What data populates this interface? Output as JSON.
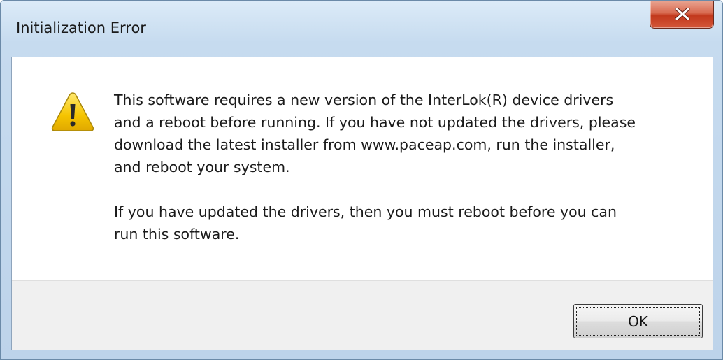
{
  "window": {
    "title": "Initialization Error",
    "close_icon": "close-x-icon"
  },
  "content": {
    "icon": "warning-icon",
    "paragraph_1": "This software requires a new version of the InterLok(R) device drivers\nand a reboot before running. If you have not updated the drivers, please\ndownload the latest installer from www.paceap.com, run the installer,\nand reboot your system.",
    "paragraph_2": "If you have updated the drivers, then you must reboot before you can\nrun this software."
  },
  "buttons": {
    "ok_label": "OK"
  },
  "colors": {
    "frame": "#c6dbef",
    "close_button": "#c7422a",
    "warning_fill": "#f5c400",
    "button_area": "#f0f0f0"
  }
}
